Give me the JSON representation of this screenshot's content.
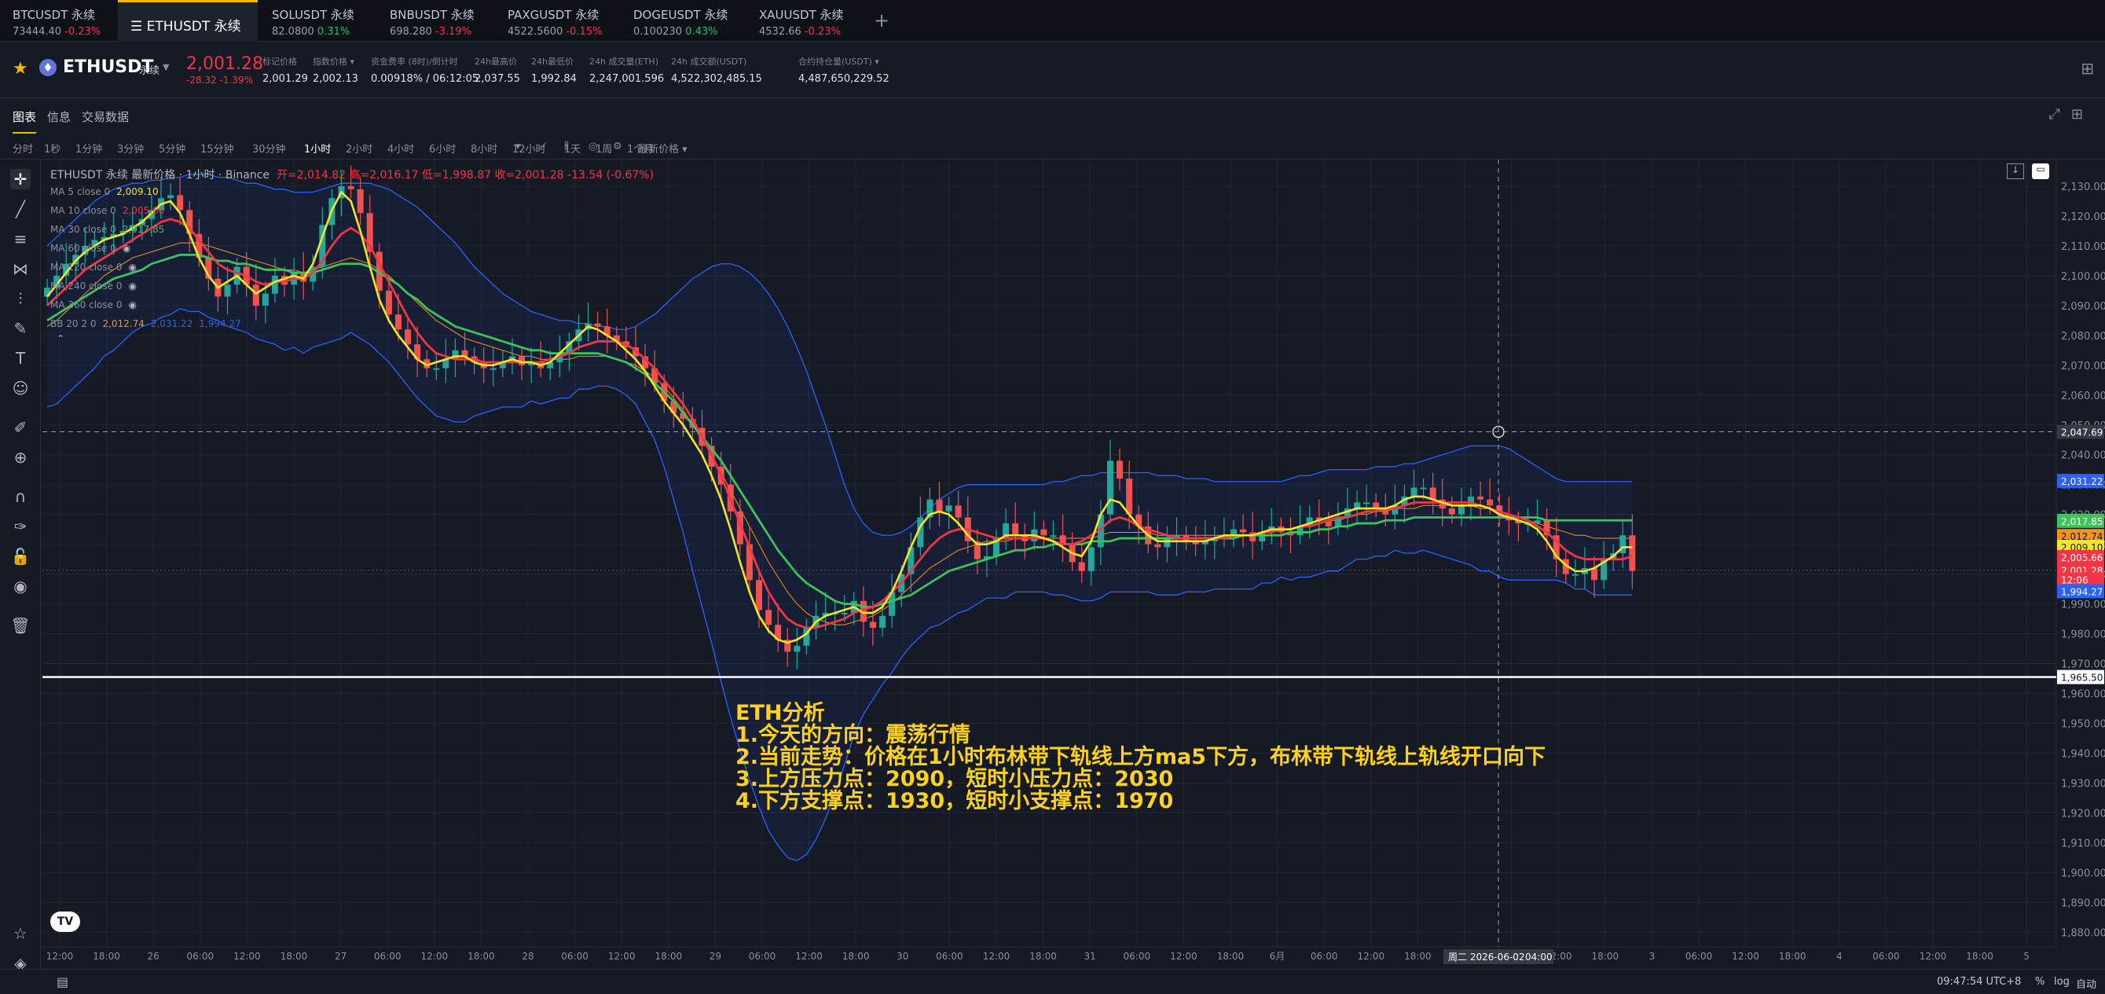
{
  "tabs": [
    {
      "name": "BTCUSDT 永续",
      "price": "73444.40",
      "change": "-0.23%",
      "dir": "down",
      "active": false
    },
    {
      "name": "ETHUSDT 永续",
      "price": "",
      "change": "",
      "dir": "down",
      "active": true
    },
    {
      "name": "SOLUSDT 永续",
      "price": "82.0800",
      "change": "0.31%",
      "dir": "up",
      "active": false
    },
    {
      "name": "BNBUSDT 永续",
      "price": "698.280",
      "change": "-3.19%",
      "dir": "down",
      "active": false
    },
    {
      "name": "PAXGUSDT 永续",
      "price": "4522.5600",
      "change": "-0.15%",
      "dir": "down",
      "active": false
    },
    {
      "name": "DOGEUSDT 永续",
      "price": "0.100230",
      "change": "0.43%",
      "dir": "up",
      "active": false
    },
    {
      "name": "XAUUSDT 永续",
      "price": "4532.66",
      "change": "-0.23%",
      "dir": "down",
      "active": false
    }
  ],
  "tab_add": "+",
  "symbol": {
    "name": "ETHUSDT",
    "badge": "永续",
    "last_price": "2,001.28",
    "change": "-28.32 -1.39%"
  },
  "stats": [
    {
      "label": "标记价格",
      "value": "2,001.29",
      "red": false
    },
    {
      "label": "指数价格 ▾",
      "value": "2,002.13",
      "red": false
    },
    {
      "label": "资金费率 (8时)/倒计时",
      "value": "0.00918%",
      "extra": " / 06:12:05",
      "red": true
    },
    {
      "label": "24h最高价",
      "value": "2,037.55",
      "red": false
    },
    {
      "label": "24h最低价",
      "value": "1,992.84",
      "red": false
    },
    {
      "label": "24h 成交量(ETH)",
      "value": "2,247,001.596",
      "red": false
    },
    {
      "label": "24h 成交额(USDT)",
      "value": "4,522,302,485.15",
      "red": false
    },
    {
      "label": "合约持仓量(USDT) ▾",
      "value": "4,487,650,229.52",
      "red": false
    }
  ],
  "subtabs": [
    "图表",
    "信息",
    "交易数据"
  ],
  "intervals": [
    "分时",
    "1秒",
    "1分钟",
    "3分钟",
    "5分钟",
    "15分钟",
    "30分钟",
    "1小时",
    "2小时",
    "4小时",
    "6小时",
    "8小时",
    "12小时",
    "1天",
    "1周",
    "1个月"
  ],
  "active_interval": "1小时",
  "price_type": "最新价格 ▾",
  "legend": {
    "title": "ETHUSDT 永续 最新价格 · 1小时 · Binance",
    "ohlc": "开=2,014.82 高=2,016.17 低=1,998.87 收=2,001.28 -13.54 (-0.67%)",
    "indicators": [
      {
        "name": "MA 5 close 0",
        "value": "2,009.10",
        "color": "#f5e625"
      },
      {
        "name": "MA 10 close 0",
        "value": "2,005.66",
        "color": "#f23645"
      },
      {
        "name": "MA 30 close 0",
        "value": "2,017.85",
        "color": "#3ec259"
      },
      {
        "name": "MA 60 close 0",
        "value": "",
        "color": "#8b8f9a"
      },
      {
        "name": "MA 120 close 0",
        "value": "",
        "color": "#8b8f9a"
      },
      {
        "name": "MA 240 close 0",
        "value": "",
        "color": "#8b8f9a"
      },
      {
        "name": "MA 360 close 0",
        "value": "",
        "color": "#8b8f9a"
      }
    ],
    "bb": {
      "name": "BB 20 2 0",
      "mid": "2,012.74",
      "upper": "2,031.22",
      "lower": "1,994.27"
    }
  },
  "analysis": [
    "ETH分析",
    "1.今天的方向：震荡行情",
    "2.当前走势：价格在1小时布林带下轨线上方ma5下方，布林带下轨线上轨线开口向下",
    "3.上方压力点：2090，短时小压力点：2030",
    "4.下方支撑点：1930，短时小支撑点：1970"
  ],
  "chart_data": {
    "type": "candlestick",
    "ylim": [
      1870,
      2140
    ],
    "y_ticks": [
      "2,130.00",
      "2,120.00",
      "2,110.00",
      "2,100.00",
      "2,090.00",
      "2,080.00",
      "2,070.00",
      "2,060.00",
      "2,050.00",
      "2,040.00",
      "2,030.00",
      "2,020.00",
      "2,010.00",
      "2,000.00",
      "1,990.00",
      "1,980.00",
      "1,970.00",
      "1,960.00",
      "1,950.00",
      "1,940.00",
      "1,930.00",
      "1,920.00",
      "1,910.00",
      "1,900.00",
      "1,890.00",
      "1,880.00"
    ],
    "x_ticks": [
      "12:00",
      "18:00",
      "26",
      "06:00",
      "12:00",
      "18:00",
      "27",
      "06:00",
      "12:00",
      "18:00",
      "28",
      "06:00",
      "12:00",
      "18:00",
      "29",
      "06:00",
      "12:00",
      "18:00",
      "30",
      "06:00",
      "12:00",
      "18:00",
      "31",
      "06:00",
      "12:00",
      "18:00",
      "6月",
      "06:00",
      "12:00",
      "18:00",
      "2",
      "04:00",
      "12:00",
      "18:00",
      "3",
      "06:00",
      "12:00",
      "18:00",
      "4",
      "06:00",
      "12:00",
      "18:00",
      "5"
    ],
    "crosshair_x_label": "周二 2026-06-02",
    "crosshair_time": "04:00",
    "crosshair_price": "2,047.69",
    "crosshair_value": 2047.69,
    "horizontal_line": {
      "value": 1965.5,
      "label": "1,965.50"
    },
    "price_tags": [
      {
        "label": "2,031.22",
        "value": 2031.22,
        "color": "#2962ff"
      },
      {
        "label": "2,017.85",
        "value": 2017.85,
        "color": "#3ec259"
      },
      {
        "label": "2,012.74",
        "value": 2012.74,
        "color": "#f7931a"
      },
      {
        "label": "2,009.10",
        "value": 2009.1,
        "color": "#f5e625"
      },
      {
        "label": "2,005.66",
        "value": 2005.66,
        "color": "#f23645"
      },
      {
        "label": "2,001.28",
        "value": 2001.28,
        "color": "#f23645"
      },
      {
        "label": "12:06",
        "value": 1998.2,
        "color": "#f23645"
      },
      {
        "label": "1,994.27",
        "value": 1994.27,
        "color": "#2962ff"
      }
    ],
    "closes": [
      2096,
      2100,
      2104,
      2107,
      2110,
      2112,
      2113,
      2114,
      2115,
      2117,
      2119,
      2122,
      2126,
      2127,
      2122,
      2114,
      2106,
      2099,
      2093,
      2097,
      2103,
      2097,
      2090,
      2094,
      2100,
      2097,
      2101,
      2098,
      2103,
      2117,
      2126,
      2130,
      2129,
      2121,
      2108,
      2095,
      2087,
      2082,
      2077,
      2072,
      2069,
      2069,
      2072,
      2075,
      2073,
      2071,
      2069,
      2069,
      2071,
      2073,
      2070,
      2071,
      2069,
      2071,
      2074,
      2078,
      2082,
      2084,
      2083,
      2080,
      2078,
      2076,
      2073,
      2069,
      2064,
      2058,
      2054,
      2052,
      2049,
      2043,
      2036,
      2030,
      2021,
      2010,
      1998,
      1988,
      1983,
      1978,
      1974,
      1976,
      1982,
      1986,
      1987,
      1987,
      1987,
      1991,
      1984,
      1982,
      1986,
      1994,
      2000,
      2009,
      2019,
      2025,
      2021,
      2023,
      2019,
      2011,
      2005,
      2006,
      2012,
      2017,
      2013,
      2011,
      2015,
      2013,
      2013,
      2010,
      2004,
      2001,
      2009,
      2020,
      2038,
      2032,
      2020,
      2016,
      2010,
      2009,
      2012,
      2013,
      2011,
      2010,
      2011,
      2012,
      2013,
      2015,
      2014,
      2011,
      2014,
      2016,
      2014,
      2013,
      2016,
      2019,
      2018,
      2016,
      2019,
      2022,
      2024,
      2024,
      2022,
      2020,
      2023,
      2026,
      2029,
      2029,
      2025,
      2022,
      2020,
      2023,
      2026,
      2025,
      2023,
      2020,
      2018,
      2017,
      2017,
      2018,
      2013,
      2005,
      2000,
      2000,
      2002,
      1998,
      2005,
      2007,
      2013,
      2001
    ],
    "ma5": [
      2093,
      2097,
      2101,
      2105,
      2108,
      2110,
      2112,
      2113,
      2114,
      2116,
      2118,
      2121,
      2124,
      2125,
      2121,
      2114,
      2106,
      2100,
      2096,
      2098,
      2100,
      2097,
      2094,
      2096,
      2098,
      2099,
      2100,
      2099,
      2104,
      2113,
      2122,
      2128,
      2125,
      2115,
      2103,
      2092,
      2085,
      2080,
      2076,
      2072,
      2070,
      2071,
      2072,
      2073,
      2073,
      2071,
      2070,
      2070,
      2071,
      2072,
      2071,
      2071,
      2070,
      2071,
      2074,
      2077,
      2080,
      2083,
      2082,
      2080,
      2078,
      2075,
      2072,
      2068,
      2063,
      2058,
      2054,
      2050,
      2045,
      2040,
      2033,
      2025,
      2015,
      2004,
      1994,
      1986,
      1981,
      1978,
      1977,
      1978,
      1980,
      1984,
      1986,
      1987,
      1988,
      1989,
      1987,
      1987,
      1989,
      1994,
      2001,
      2009,
      2016,
      2020,
      2021,
      2020,
      2017,
      2013,
      2010,
      2010,
      2011,
      2013,
      2013,
      2013,
      2013,
      2012,
      2011,
      2009,
      2007,
      2006,
      2011,
      2020,
      2025,
      2024,
      2020,
      2016,
      2013,
      2011,
      2011,
      2011,
      2011,
      2011,
      2011,
      2012,
      2013,
      2013,
      2013,
      2013,
      2014,
      2015,
      2015,
      2015,
      2016,
      2017,
      2018,
      2019,
      2020,
      2021,
      2022,
      2022,
      2022,
      2022,
      2023,
      2025,
      2026,
      2026,
      2025,
      2024,
      2023,
      2023,
      2023,
      2023,
      2022,
      2020,
      2019,
      2018,
      2017,
      2015,
      2011,
      2006,
      2003,
      2001,
      2001,
      2002,
      2004,
      2006,
      2009,
      2009
    ],
    "ma10": [
      2090,
      2093,
      2096,
      2099,
      2102,
      2104,
      2106,
      2108,
      2110,
      2112,
      2114,
      2116,
      2118,
      2119,
      2118,
      2116,
      2112,
      2108,
      2104,
      2102,
      2101,
      2100,
      2098,
      2097,
      2098,
      2098,
      2099,
      2099,
      2101,
      2105,
      2110,
      2114,
      2116,
      2114,
      2110,
      2104,
      2098,
      2092,
      2086,
      2081,
      2077,
      2074,
      2073,
      2072,
      2072,
      2072,
      2071,
      2071,
      2071,
      2071,
      2071,
      2071,
      2071,
      2072,
      2073,
      2074,
      2076,
      2077,
      2078,
      2078,
      2078,
      2077,
      2075,
      2072,
      2069,
      2065,
      2061,
      2057,
      2052,
      2046,
      2040,
      2033,
      2025,
      2017,
      2009,
      2001,
      1994,
      1989,
      1985,
      1983,
      1982,
      1982,
      1983,
      1984,
      1985,
      1987,
      1988,
      1989,
      1991,
      1994,
      1997,
      2001,
      2005,
      2009,
      2012,
      2014,
      2015,
      2015,
      2014,
      2013,
      2012,
      2012,
      2012,
      2012,
      2012,
      2012,
      2011,
      2010,
      2010,
      2011,
      2013,
      2015,
      2018,
      2019,
      2018,
      2016,
      2015,
      2014,
      2013,
      2012,
      2012,
      2012,
      2012,
      2012,
      2012,
      2013,
      2013,
      2013,
      2014,
      2014,
      2015,
      2015,
      2016,
      2016,
      2017,
      2018,
      2019,
      2019,
      2020,
      2021,
      2021,
      2022,
      2022,
      2023,
      2024,
      2024,
      2024,
      2024,
      2024,
      2024,
      2024,
      2023,
      2022,
      2021,
      2020,
      2019,
      2018,
      2016,
      2014,
      2011,
      2008,
      2006,
      2005,
      2005,
      2005,
      2005,
      2005,
      2006
    ],
    "ma30": [
      2085,
      2087,
      2089,
      2091,
      2093,
      2095,
      2097,
      2099,
      2100,
      2101,
      2102,
      2104,
      2105,
      2106,
      2107,
      2107,
      2107,
      2106,
      2105,
      2105,
      2104,
      2104,
      2103,
      2102,
      2102,
      2102,
      2101,
      2101,
      2101,
      2102,
      2103,
      2104,
      2104,
      2104,
      2103,
      2101,
      2099,
      2097,
      2094,
      2092,
      2089,
      2087,
      2085,
      2083,
      2082,
      2081,
      2080,
      2079,
      2078,
      2077,
      2076,
      2075,
      2075,
      2074,
      2074,
      2074,
      2074,
      2074,
      2074,
      2073,
      2072,
      2071,
      2069,
      2067,
      2064,
      2061,
      2058,
      2054,
      2050,
      2046,
      2042,
      2038,
      2033,
      2028,
      2023,
      2018,
      2013,
      2008,
      2004,
      2000,
      1997,
      1995,
      1993,
      1991,
      1990,
      1990,
      1989,
      1989,
      1990,
      1991,
      1992,
      1993,
      1995,
      1997,
      1999,
      2001,
      2002,
      2003,
      2004,
      2005,
      2006,
      2007,
      2008,
      2008,
      2009,
      2009,
      2010,
      2010,
      2010,
      2010,
      2011,
      2011,
      2011,
      2012,
      2012,
      2012,
      2012,
      2012,
      2012,
      2012,
      2012,
      2012,
      2012,
      2012,
      2012,
      2012,
      2013,
      2013,
      2013,
      2013,
      2013,
      2014,
      2014,
      2014,
      2015,
      2015,
      2016,
      2016,
      2017,
      2017,
      2017,
      2018,
      2018,
      2018,
      2019,
      2019,
      2019,
      2019,
      2019,
      2019,
      2019,
      2019,
      2019,
      2019,
      2019,
      2019,
      2019,
      2019,
      2018,
      2018,
      2018,
      2018,
      2018,
      2018,
      2018,
      2018,
      2018,
      2018
    ],
    "bb_mid": [
      2083,
      2085,
      2088,
      2091,
      2094,
      2097,
      2100,
      2102,
      2104,
      2106,
      2107,
      2108,
      2109,
      2110,
      2111,
      2111,
      2111,
      2110,
      2109,
      2108,
      2107,
      2106,
      2105,
      2104,
      2103,
      2102,
      2102,
      2101,
      2102,
      2103,
      2104,
      2105,
      2106,
      2105,
      2104,
      2102,
      2100,
      2097,
      2094,
      2091,
      2088,
      2085,
      2083,
      2081,
      2079,
      2078,
      2077,
      2076,
      2075,
      2074,
      2073,
      2073,
      2072,
      2072,
      2072,
      2072,
      2073,
      2073,
      2073,
      2073,
      2072,
      2071,
      2070,
      2068,
      2066,
      2063,
      2059,
      2055,
      2050,
      2045,
      2040,
      2034,
      2028,
      2022,
      2016,
      2010,
      2004,
      1999,
      1994,
      1990,
      1987,
      1985,
      1984,
      1983,
      1983,
      1984,
      1985,
      1986,
      1988,
      1990,
      1993,
      1996,
      1999,
      2002,
      2004,
      2006,
      2008,
      2009,
      2010,
      2011,
      2011,
      2011,
      2012,
      2012,
      2012,
      2012,
      2012,
      2012,
      2012,
      2012,
      2012,
      2013,
      2014,
      2014,
      2014,
      2014,
      2014,
      2013,
      2013,
      2013,
      2013,
      2013,
      2013,
      2013,
      2013,
      2013,
      2013,
      2013,
      2014,
      2014,
      2015,
      2015,
      2016,
      2016,
      2017,
      2018,
      2018,
      2019,
      2020,
      2020,
      2021,
      2021,
      2022,
      2022,
      2022,
      2023,
      2023,
      2023,
      2023,
      2023,
      2023,
      2022,
      2022,
      2021,
      2020,
      2019,
      2018,
      2017,
      2016,
      2015,
      2014,
      2013,
      2013,
      2012,
      2012,
      2012,
      2012,
      2012
    ],
    "bb_upper": [
      2110,
      2113,
      2116,
      2119,
      2122,
      2125,
      2127,
      2129,
      2130,
      2131,
      2131,
      2132,
      2132,
      2133,
      2133,
      2134,
      2134,
      2134,
      2133,
      2133,
      2132,
      2131,
      2131,
      2130,
      2129,
      2129,
      2128,
      2128,
      2128,
      2129,
      2130,
      2131,
      2131,
      2131,
      2131,
      2130,
      2129,
      2127,
      2125,
      2123,
      2120,
      2117,
      2114,
      2111,
      2107,
      2103,
      2100,
      2097,
      2094,
      2092,
      2090,
      2088,
      2087,
      2086,
      2085,
      2085,
      2084,
      2084,
      2083,
      2083,
      2082,
      2082,
      2083,
      2085,
      2087,
      2090,
      2093,
      2096,
      2099,
      2101,
      2103,
      2104,
      2104,
      2103,
      2101,
      2098,
      2094,
      2089,
      2083,
      2076,
      2068,
      2059,
      2050,
      2040,
      2030,
      2022,
      2017,
      2014,
      2013,
      2013,
      2014,
      2016,
      2019,
      2022,
      2025,
      2027,
      2029,
      2030,
      2030,
      2030,
      2030,
      2030,
      2030,
      2030,
      2030,
      2030,
      2031,
      2031,
      2032,
      2033,
      2033,
      2034,
      2034,
      2034,
      2034,
      2034,
      2034,
      2033,
      2033,
      2033,
      2032,
      2032,
      2032,
      2031,
      2031,
      2031,
      2031,
      2031,
      2031,
      2031,
      2031,
      2032,
      2033,
      2033,
      2034,
      2035,
      2035,
      2035,
      2035,
      2035,
      2036,
      2036,
      2036,
      2037,
      2037,
      2038,
      2039,
      2040,
      2041,
      2042,
      2043,
      2043,
      2043,
      2043,
      2042,
      2040,
      2038,
      2036,
      2034,
      2032,
      2031,
      2031,
      2031,
      2031,
      2031,
      2031,
      2031,
      2031
    ],
    "bb_lower": [
      2056,
      2057,
      2060,
      2063,
      2066,
      2069,
      2073,
      2075,
      2078,
      2081,
      2083,
      2084,
      2086,
      2087,
      2089,
      2088,
      2088,
      2086,
      2085,
      2083,
      2082,
      2081,
      2079,
      2078,
      2077,
      2075,
      2076,
      2074,
      2076,
      2077,
      2078,
      2079,
      2081,
      2079,
      2077,
      2074,
      2071,
      2067,
      2063,
      2059,
      2056,
      2053,
      2052,
      2051,
      2051,
      2053,
      2054,
      2055,
      2056,
      2056,
      2056,
      2058,
      2057,
      2058,
      2059,
      2059,
      2062,
      2062,
      2063,
      2063,
      2062,
      2060,
      2057,
      2051,
      2045,
      2036,
      2025,
      2014,
      2001,
      1989,
      1977,
      1964,
      1952,
      1941,
      1931,
      1922,
      1914,
      1909,
      1905,
      1904,
      1906,
      1911,
      1918,
      1926,
      1936,
      1946,
      1953,
      1958,
      1963,
      1967,
      1972,
      1976,
      1979,
      1982,
      1983,
      1985,
      1987,
      1988,
      1990,
      1992,
      1992,
      1992,
      1994,
      1994,
      1994,
      1994,
      1993,
      1993,
      1992,
      1991,
      1991,
      1992,
      1994,
      1994,
      1994,
      1994,
      1994,
      1993,
      1993,
      1993,
      1994,
      1994,
      1994,
      1995,
      1995,
      1995,
      1995,
      1995,
      1997,
      1997,
      1999,
      1998,
      1999,
      1999,
      2000,
      2001,
      2001,
      2003,
      2005,
      2005,
      2006,
      2006,
      2008,
      2007,
      2007,
      2008,
      2007,
      2006,
      2005,
      2004,
      2003,
      2001,
      2001,
      1999,
      1998,
      1998,
      1998,
      1998,
      1998,
      1998,
      1997,
      1995,
      1995,
      1993,
      1993,
      1993,
      1993,
      1993
    ]
  },
  "bottom": {
    "time": "09:47:54 UTC+8",
    "pct": "%",
    "log": "log",
    "auto": "自动"
  }
}
